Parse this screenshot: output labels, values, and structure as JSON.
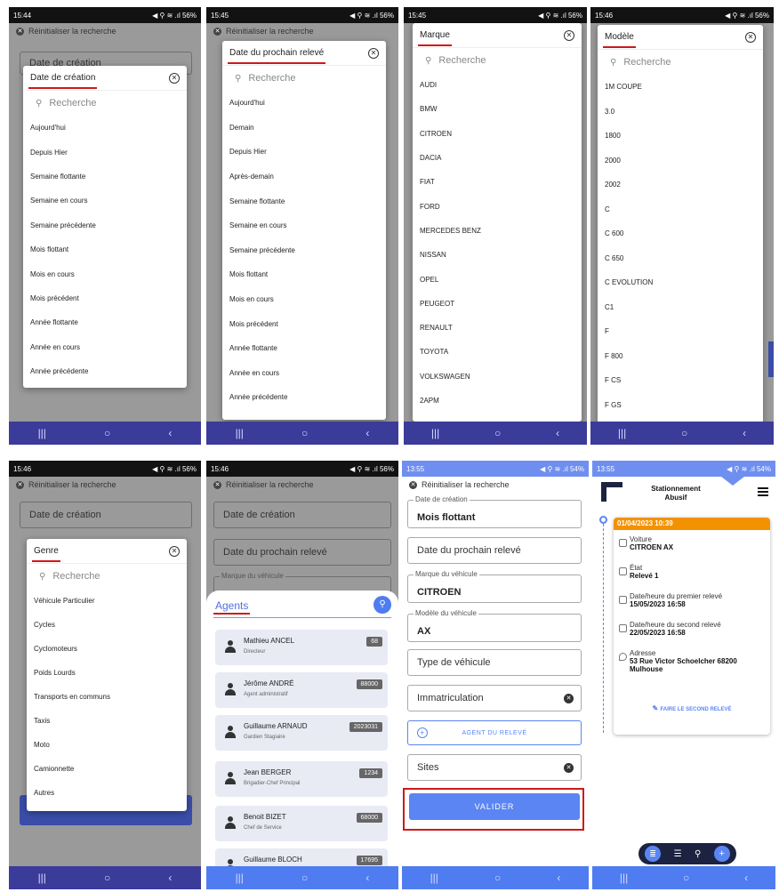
{
  "p1": {
    "time": "15:44",
    "sys": "◀ ⚲ ≋ .ıl 56%",
    "reset": "Réinitialiser la recherche",
    "bg_field": "Date de création",
    "title": "Date de création",
    "search": "Recherche",
    "items": [
      "Aujourd'hui",
      "Depuis Hier",
      "Semaine flottante",
      "Semaine en cours",
      "Semaine précédente",
      "Mois flottant",
      "Mois en cours",
      "Mois précédent",
      "Année flottante",
      "Année en cours",
      "Année précédente"
    ]
  },
  "p2": {
    "time": "15:45",
    "sys": "◀ ⚲ ≋ .ıl 56%",
    "reset": "Réinitialiser la recherche",
    "title": "Date du prochain relevé",
    "search": "Recherche",
    "items": [
      "Aujourd'hui",
      "Demain",
      "Depuis Hier",
      "Après-demain",
      "Semaine flottante",
      "Semaine en cours",
      "Semaine précédente",
      "Mois flottant",
      "Mois en cours",
      "Mois précédent",
      "Année flottante",
      "Année en cours",
      "Année précédente"
    ]
  },
  "p3": {
    "time": "15:45",
    "sys": "◀ ⚲ ≋ .ıl 56%",
    "title": "Marque",
    "search": "Recherche",
    "items": [
      "AUDI",
      "BMW",
      "CITROEN",
      "DACIA",
      "FIAT",
      "FORD",
      "MERCEDES BENZ",
      "NISSAN",
      "OPEL",
      "PEUGEOT",
      "RENAULT",
      "TOYOTA",
      "VOLKSWAGEN",
      "2APM"
    ]
  },
  "p4": {
    "time": "15:46",
    "sys": "◀ ⚲ ≋ .ıl 56%",
    "title": "Modèle",
    "search": "Recherche",
    "items": [
      "1M COUPE",
      "3.0",
      "1800",
      "2000",
      "2002",
      "C",
      "C 600",
      "C 650",
      "C EVOLUTION",
      "C1",
      "F",
      "F 800",
      "F CS",
      "F GS"
    ]
  },
  "p5": {
    "time": "15:46",
    "sys": "◀ ⚲ ≋ .ıl 56%",
    "reset": "Réinitialiser la recherche",
    "bg_field": "Date de création",
    "title": "Genre",
    "search": "Recherche",
    "items": [
      "Véhicule Particulier",
      "Cycles",
      "Cyclomoteurs",
      "Poids Lourds",
      "Transports en communs",
      "Taxis",
      "Moto",
      "Camionnette",
      "Autres"
    ]
  },
  "p6": {
    "time": "15:46",
    "sys": "◀ ⚲ ≋ .ıl 56%",
    "reset": "Réinitialiser la recherche",
    "f1": "Date de création",
    "f2": "Date du prochain relevé",
    "f3_label": "Marque du véhicule",
    "title": "Agents",
    "agents": [
      {
        "name": "Mathieu ANCEL",
        "role": "Directeur",
        "badge": "68"
      },
      {
        "name": "Jérôme ANDRÉ",
        "role": "Agent administratif",
        "badge": "88000"
      },
      {
        "name": "Guillaume ARNAUD",
        "role": "Gardien Stagiaire",
        "badge": "2023031"
      },
      {
        "name": "Jean BERGER",
        "role": "Brigadier-Chef Principal",
        "badge": "1234"
      },
      {
        "name": "Benoit BIZET",
        "role": "Chef de Service",
        "badge": "68000"
      },
      {
        "name": "Guillaume BLOCH",
        "role": "",
        "badge": "17695"
      }
    ]
  },
  "p7": {
    "time": "13:55",
    "sys": "◀ ⚲ ≋ .ıl 54%",
    "reset": "Réinitialiser la recherche",
    "f_date_label": "Date de création",
    "f_date_val": "Mois flottant",
    "f_next": "Date du prochain relevé",
    "f_marque_label": "Marque du véhicule",
    "f_marque_val": "CITROEN",
    "f_modele_label": "Modèle du véhicule",
    "f_modele_val": "AX",
    "f_type": "Type de véhicule",
    "f_immat": "Immatriculation",
    "agent_btn": "AGENT DU RELEVÉ",
    "f_sites": "Sites",
    "valider": "VALIDER"
  },
  "p8": {
    "time": "13:55",
    "sys": "◀ ⚲ ≋ .ıl 54%",
    "app_title": "Stationnement Abusif",
    "date": "01/04/2023 10:39",
    "rows": [
      {
        "label": "Voiture",
        "value": "CITROEN AX"
      },
      {
        "label": "État",
        "value": "Relevé 1"
      },
      {
        "label": "Date/heure du premier relevé",
        "value": "15/05/2023 16:58"
      },
      {
        "label": "Date/heure du second relevé",
        "value": "22/05/2023 16:58"
      },
      {
        "label": "Adresse",
        "value": "53 Rue Victor Schoelcher 68200 Mulhouse"
      }
    ],
    "action": "FAIRE LE SECOND RELEVÉ"
  },
  "nav": [
    "|||",
    "○",
    "‹"
  ],
  "colors": {
    "accent": "#5b85f2",
    "orange": "#f39200",
    "red": "#d01818",
    "navy": "#1c2340"
  }
}
